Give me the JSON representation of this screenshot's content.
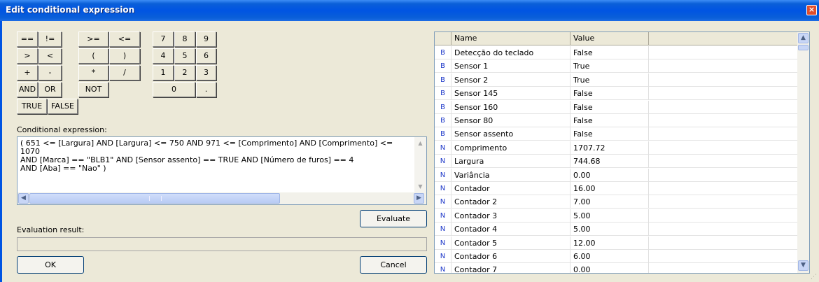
{
  "window": {
    "title": "Edit conditional expression",
    "close": "×"
  },
  "operators": [
    "==",
    "!=",
    ">=",
    "<=",
    ">",
    "<",
    "(",
    ")",
    "+",
    "-",
    "*",
    "/",
    "AND",
    "OR",
    "NOT",
    "TRUE",
    "FALSE"
  ],
  "digits": [
    "7",
    "8",
    "9",
    "4",
    "5",
    "6",
    "1",
    "2",
    "3",
    "0",
    "."
  ],
  "expression": {
    "label": "Conditional expression:",
    "lines": [
      "( 651 <= [Largura] AND [Largura] <= 750 AND 971 <= [Comprimento] AND [Comprimento] <= 1070",
      "AND [Marca] == \"BLB1\" AND [Sensor assento] == TRUE AND [Número de furos] == 4",
      "AND [Aba] == \"Nao\" )"
    ]
  },
  "evaluate_button": "Evaluate",
  "result": {
    "label": "Evaluation result:",
    "value": ""
  },
  "ok_button": "OK",
  "cancel_button": "Cancel",
  "variables": {
    "columns": [
      "Name",
      "Value"
    ],
    "rows": [
      {
        "type": "B",
        "name": "Detecção do teclado",
        "value": "False"
      },
      {
        "type": "B",
        "name": "Sensor 1",
        "value": "True"
      },
      {
        "type": "B",
        "name": "Sensor 2",
        "value": "True"
      },
      {
        "type": "B",
        "name": "Sensor 145",
        "value": "False"
      },
      {
        "type": "B",
        "name": "Sensor 160",
        "value": "False"
      },
      {
        "type": "B",
        "name": "Sensor 80",
        "value": "False"
      },
      {
        "type": "B",
        "name": "Sensor assento",
        "value": "False"
      },
      {
        "type": "N",
        "name": "Comprimento",
        "value": "1707.72"
      },
      {
        "type": "N",
        "name": "Largura",
        "value": "744.68"
      },
      {
        "type": "N",
        "name": "Variância",
        "value": "0.00"
      },
      {
        "type": "N",
        "name": "Contador",
        "value": "16.00"
      },
      {
        "type": "N",
        "name": "Contador 2",
        "value": "7.00"
      },
      {
        "type": "N",
        "name": "Contador 3",
        "value": "5.00"
      },
      {
        "type": "N",
        "name": "Contador 4",
        "value": "5.00"
      },
      {
        "type": "N",
        "name": "Contador 5",
        "value": "12.00"
      },
      {
        "type": "N",
        "name": "Contador 6",
        "value": "6.00"
      },
      {
        "type": "N",
        "name": "Contador 7",
        "value": "0.00"
      }
    ]
  },
  "colors": {
    "titlebar": "#0054e3",
    "dialog_bg": "#ece9d8",
    "type_letter": "#1a35c8"
  }
}
